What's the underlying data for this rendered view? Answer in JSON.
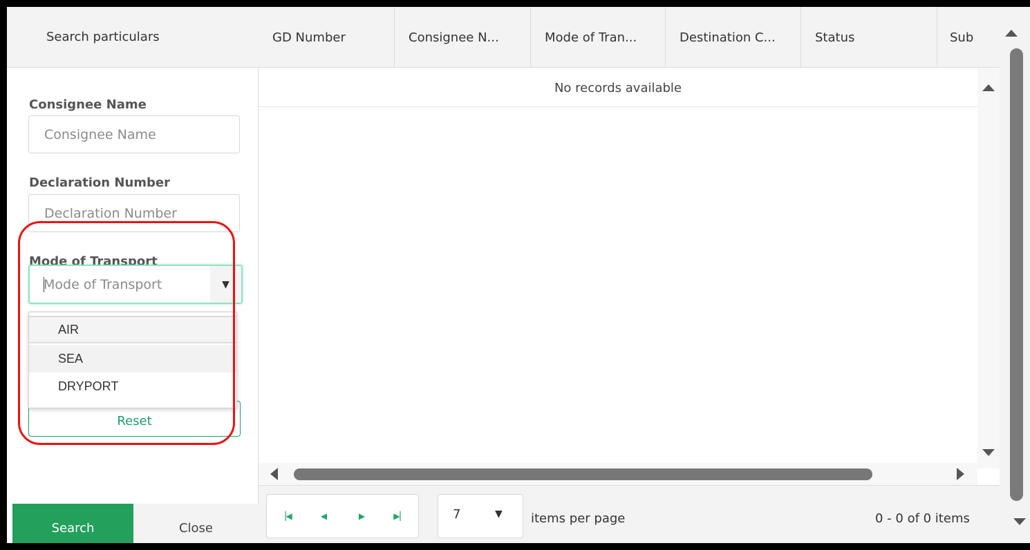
{
  "panel": {
    "title": "Search particulars",
    "fields": [
      {
        "label": "Consignee Name",
        "placeholder": "Consignee Name"
      },
      {
        "label": "Declaration Number",
        "placeholder": "Declaration Number"
      },
      {
        "label": "Mode of Transport",
        "placeholder": "Mode of Transport"
      }
    ],
    "transport_options": [
      "AIR",
      "SEA",
      "DRYPORT"
    ],
    "reset_label": "Reset",
    "search_label": "Search",
    "close_label": "Close"
  },
  "grid": {
    "columns": [
      "GD Number",
      "Consignee N...",
      "Mode of Tran...",
      "Destination C...",
      "Status",
      "Sub"
    ],
    "empty_message": "No records available"
  },
  "pager": {
    "page_size": "7",
    "items_per_page_label": "items per page",
    "count_label": "0 - 0 of 0 items"
  },
  "icons": {
    "first": "first-page-icon",
    "prev": "prev-page-icon",
    "next": "next-page-icon",
    "last": "last-page-icon",
    "dropdown": "chevron-down-icon"
  },
  "colors": {
    "accent": "#22a05c",
    "focus": "#8ee4c2",
    "highlight": "#ee1111"
  }
}
